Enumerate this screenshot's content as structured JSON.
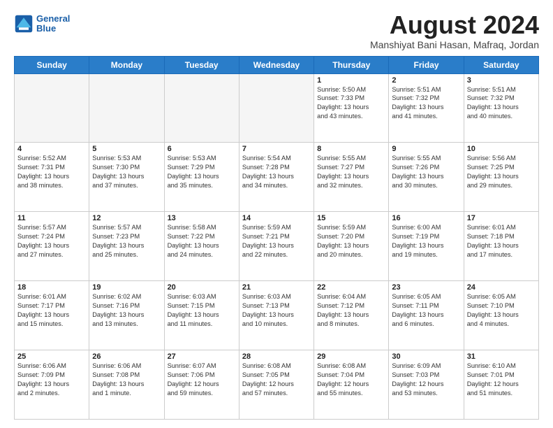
{
  "header": {
    "logo_line1": "General",
    "logo_line2": "Blue",
    "month_title": "August 2024",
    "location": "Manshiyat Bani Hasan, Mafraq, Jordan"
  },
  "weekdays": [
    "Sunday",
    "Monday",
    "Tuesday",
    "Wednesday",
    "Thursday",
    "Friday",
    "Saturday"
  ],
  "weeks": [
    [
      {
        "day": "",
        "info": ""
      },
      {
        "day": "",
        "info": ""
      },
      {
        "day": "",
        "info": ""
      },
      {
        "day": "",
        "info": ""
      },
      {
        "day": "1",
        "info": "Sunrise: 5:50 AM\nSunset: 7:33 PM\nDaylight: 13 hours\nand 43 minutes."
      },
      {
        "day": "2",
        "info": "Sunrise: 5:51 AM\nSunset: 7:32 PM\nDaylight: 13 hours\nand 41 minutes."
      },
      {
        "day": "3",
        "info": "Sunrise: 5:51 AM\nSunset: 7:32 PM\nDaylight: 13 hours\nand 40 minutes."
      }
    ],
    [
      {
        "day": "4",
        "info": "Sunrise: 5:52 AM\nSunset: 7:31 PM\nDaylight: 13 hours\nand 38 minutes."
      },
      {
        "day": "5",
        "info": "Sunrise: 5:53 AM\nSunset: 7:30 PM\nDaylight: 13 hours\nand 37 minutes."
      },
      {
        "day": "6",
        "info": "Sunrise: 5:53 AM\nSunset: 7:29 PM\nDaylight: 13 hours\nand 35 minutes."
      },
      {
        "day": "7",
        "info": "Sunrise: 5:54 AM\nSunset: 7:28 PM\nDaylight: 13 hours\nand 34 minutes."
      },
      {
        "day": "8",
        "info": "Sunrise: 5:55 AM\nSunset: 7:27 PM\nDaylight: 13 hours\nand 32 minutes."
      },
      {
        "day": "9",
        "info": "Sunrise: 5:55 AM\nSunset: 7:26 PM\nDaylight: 13 hours\nand 30 minutes."
      },
      {
        "day": "10",
        "info": "Sunrise: 5:56 AM\nSunset: 7:25 PM\nDaylight: 13 hours\nand 29 minutes."
      }
    ],
    [
      {
        "day": "11",
        "info": "Sunrise: 5:57 AM\nSunset: 7:24 PM\nDaylight: 13 hours\nand 27 minutes."
      },
      {
        "day": "12",
        "info": "Sunrise: 5:57 AM\nSunset: 7:23 PM\nDaylight: 13 hours\nand 25 minutes."
      },
      {
        "day": "13",
        "info": "Sunrise: 5:58 AM\nSunset: 7:22 PM\nDaylight: 13 hours\nand 24 minutes."
      },
      {
        "day": "14",
        "info": "Sunrise: 5:59 AM\nSunset: 7:21 PM\nDaylight: 13 hours\nand 22 minutes."
      },
      {
        "day": "15",
        "info": "Sunrise: 5:59 AM\nSunset: 7:20 PM\nDaylight: 13 hours\nand 20 minutes."
      },
      {
        "day": "16",
        "info": "Sunrise: 6:00 AM\nSunset: 7:19 PM\nDaylight: 13 hours\nand 19 minutes."
      },
      {
        "day": "17",
        "info": "Sunrise: 6:01 AM\nSunset: 7:18 PM\nDaylight: 13 hours\nand 17 minutes."
      }
    ],
    [
      {
        "day": "18",
        "info": "Sunrise: 6:01 AM\nSunset: 7:17 PM\nDaylight: 13 hours\nand 15 minutes."
      },
      {
        "day": "19",
        "info": "Sunrise: 6:02 AM\nSunset: 7:16 PM\nDaylight: 13 hours\nand 13 minutes."
      },
      {
        "day": "20",
        "info": "Sunrise: 6:03 AM\nSunset: 7:15 PM\nDaylight: 13 hours\nand 11 minutes."
      },
      {
        "day": "21",
        "info": "Sunrise: 6:03 AM\nSunset: 7:13 PM\nDaylight: 13 hours\nand 10 minutes."
      },
      {
        "day": "22",
        "info": "Sunrise: 6:04 AM\nSunset: 7:12 PM\nDaylight: 13 hours\nand 8 minutes."
      },
      {
        "day": "23",
        "info": "Sunrise: 6:05 AM\nSunset: 7:11 PM\nDaylight: 13 hours\nand 6 minutes."
      },
      {
        "day": "24",
        "info": "Sunrise: 6:05 AM\nSunset: 7:10 PM\nDaylight: 13 hours\nand 4 minutes."
      }
    ],
    [
      {
        "day": "25",
        "info": "Sunrise: 6:06 AM\nSunset: 7:09 PM\nDaylight: 13 hours\nand 2 minutes."
      },
      {
        "day": "26",
        "info": "Sunrise: 6:06 AM\nSunset: 7:08 PM\nDaylight: 13 hours\nand 1 minute."
      },
      {
        "day": "27",
        "info": "Sunrise: 6:07 AM\nSunset: 7:06 PM\nDaylight: 12 hours\nand 59 minutes."
      },
      {
        "day": "28",
        "info": "Sunrise: 6:08 AM\nSunset: 7:05 PM\nDaylight: 12 hours\nand 57 minutes."
      },
      {
        "day": "29",
        "info": "Sunrise: 6:08 AM\nSunset: 7:04 PM\nDaylight: 12 hours\nand 55 minutes."
      },
      {
        "day": "30",
        "info": "Sunrise: 6:09 AM\nSunset: 7:03 PM\nDaylight: 12 hours\nand 53 minutes."
      },
      {
        "day": "31",
        "info": "Sunrise: 6:10 AM\nSunset: 7:01 PM\nDaylight: 12 hours\nand 51 minutes."
      }
    ]
  ]
}
